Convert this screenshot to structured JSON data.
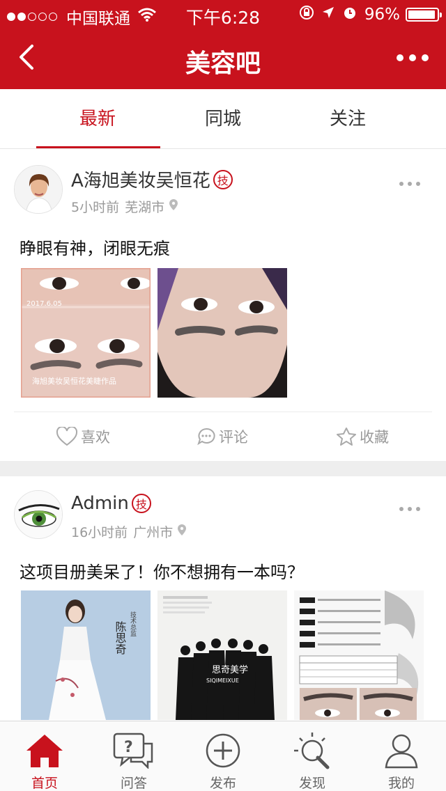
{
  "status_bar": {
    "carrier": "中国联通",
    "time": "下午6:28",
    "battery": "96%",
    "battery_level": 0.96,
    "signal_bars": 2
  },
  "nav": {
    "title": "美容吧",
    "back_icon": "chevron-left-icon",
    "more_icon": "more-horizontal-icon"
  },
  "tabs": [
    {
      "label": "最新",
      "active": true
    },
    {
      "label": "同城",
      "active": false
    },
    {
      "label": "关注",
      "active": false
    }
  ],
  "posts": [
    {
      "author": "A海旭美妆吴恒花",
      "badge": "技",
      "time_ago": "5小时前",
      "city": "芜湖市",
      "text": "睁眼有神，闭眼无痕",
      "images": [
        {
          "date_stamp": "2017.6.05",
          "watermark": "海旭美妆吴恒花美睫作品"
        },
        {}
      ],
      "actions": {
        "like": "喜欢",
        "comment": "评论",
        "favorite": "收藏"
      }
    },
    {
      "author": "Admin",
      "badge": "技",
      "time_ago": "16小时前",
      "city": "广州市",
      "text": "这项目册美呆了！你不想拥有一本吗？",
      "images": [
        {
          "caption": "陈思奇",
          "subcaption": "技术总监"
        },
        {
          "caption": "思奇美学",
          "subcaption": "SIQIMEIXUE"
        },
        {}
      ]
    }
  ],
  "bottom_tabs": [
    {
      "label": "首页",
      "icon": "home-icon",
      "active": true
    },
    {
      "label": "问答",
      "icon": "question-chat-icon",
      "active": false
    },
    {
      "label": "发布",
      "icon": "plus-circle-icon",
      "active": false
    },
    {
      "label": "发现",
      "icon": "lightbulb-icon",
      "active": false
    },
    {
      "label": "我的",
      "icon": "user-icon",
      "active": false
    }
  ],
  "colors": {
    "brand": "#c8121d",
    "text_muted": "#999999",
    "background": "#ffffff",
    "separator": "#eeeeee"
  }
}
